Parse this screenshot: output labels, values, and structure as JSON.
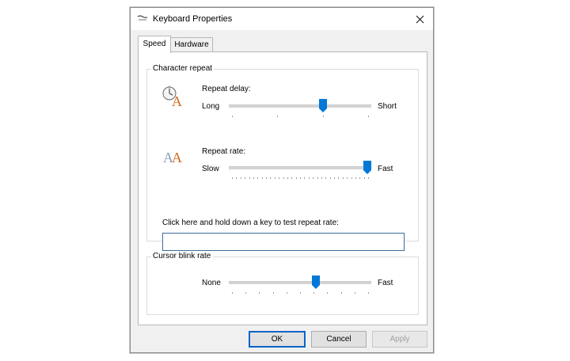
{
  "window": {
    "title": "Keyboard Properties"
  },
  "tabs": [
    {
      "label": "Speed",
      "active": true
    },
    {
      "label": "Hardware",
      "active": false
    }
  ],
  "character_repeat": {
    "group_label": "Character repeat",
    "repeat_delay": {
      "label": "Repeat delay:",
      "min_label": "Long",
      "max_label": "Short",
      "value": 0.67
    },
    "repeat_rate": {
      "label": "Repeat rate:",
      "min_label": "Slow",
      "max_label": "Fast",
      "value": 1.0
    },
    "test_label": "Click here and hold down a key to test repeat rate:",
    "test_value": ""
  },
  "cursor_blink": {
    "group_label": "Cursor blink rate",
    "min_label": "None",
    "max_label": "Fast",
    "value": 0.62
  },
  "buttons": {
    "ok": "OK",
    "cancel": "Cancel",
    "apply": "Apply"
  },
  "colors": {
    "accent": "#0078d7",
    "window_bg": "#f0f0f0",
    "panel_bg": "#ffffff"
  }
}
